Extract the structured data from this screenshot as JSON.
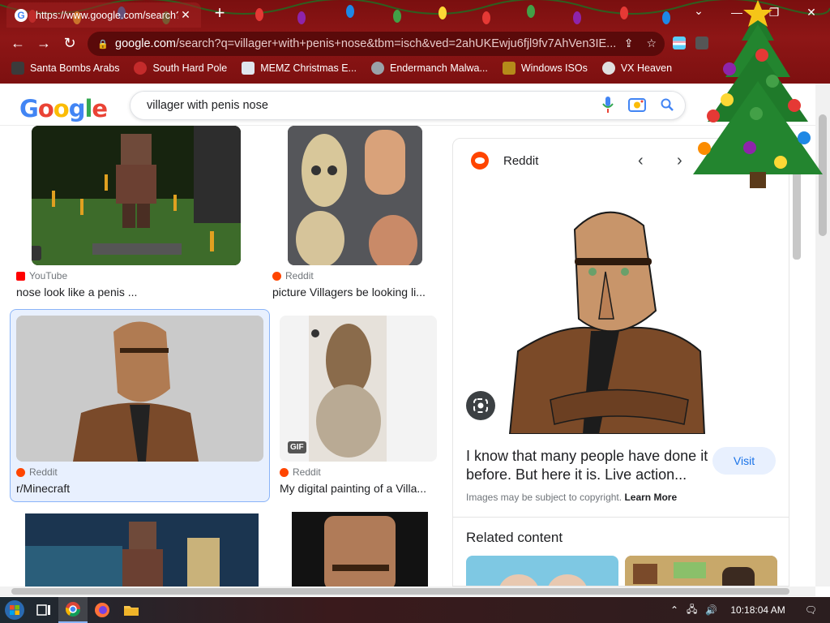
{
  "browser": {
    "tab_title": "https://www.google.com/search?",
    "tab_close": "✕",
    "new_tab": "+",
    "url_host": "google.com",
    "url_rest": "/search?q=villager+with+penis+nose&tbm=isch&ved=2ahUKEwju6fjl9fv7AhVen3IE...",
    "bookmarks": [
      {
        "label": "Santa Bombs Arabs",
        "color": "#3b3b3b"
      },
      {
        "label": "South Hard Pole",
        "color": "#c42b2b"
      },
      {
        "label": "MEMZ Christmas E...",
        "color": "#dfe6ee"
      },
      {
        "label": "Endermanch Malwa...",
        "color": "#9aa3a9"
      },
      {
        "label": "Windows ISOs",
        "color": "#b58b1a"
      },
      {
        "label": "VX Heaven",
        "color": "#e0e0e0"
      }
    ]
  },
  "google": {
    "logo_letters": [
      "G",
      "o",
      "o",
      "g",
      "l",
      "e"
    ],
    "logo_colors": [
      "#4285f4",
      "#ea4335",
      "#fbbc05",
      "#4285f4",
      "#34a853",
      "#ea4335"
    ],
    "query": "villager with penis nose"
  },
  "results": [
    {
      "source": "YouTube",
      "caption": "nose look like a penis ...",
      "source_color": "#ff0000",
      "badge": ""
    },
    {
      "source": "Reddit",
      "caption": "picture Villagers be looking li...",
      "source_color": "#ff4500",
      "badge": ""
    },
    {
      "source": "Reddit",
      "caption": "r/Minecraft",
      "source_color": "#ff4500",
      "badge": ""
    },
    {
      "source": "Reddit",
      "caption": "My digital painting of a Villa...",
      "source_color": "#ff4500",
      "badge": "GIF"
    }
  ],
  "panel": {
    "source": "Reddit",
    "title": "I know that many people have done it before. But here it is. Live action...",
    "visit": "Visit",
    "copyright": "Images may be subject to copyright.",
    "learn_more": "Learn More",
    "related": "Related content"
  },
  "taskbar": {
    "clock": "10:18:04 AM"
  }
}
